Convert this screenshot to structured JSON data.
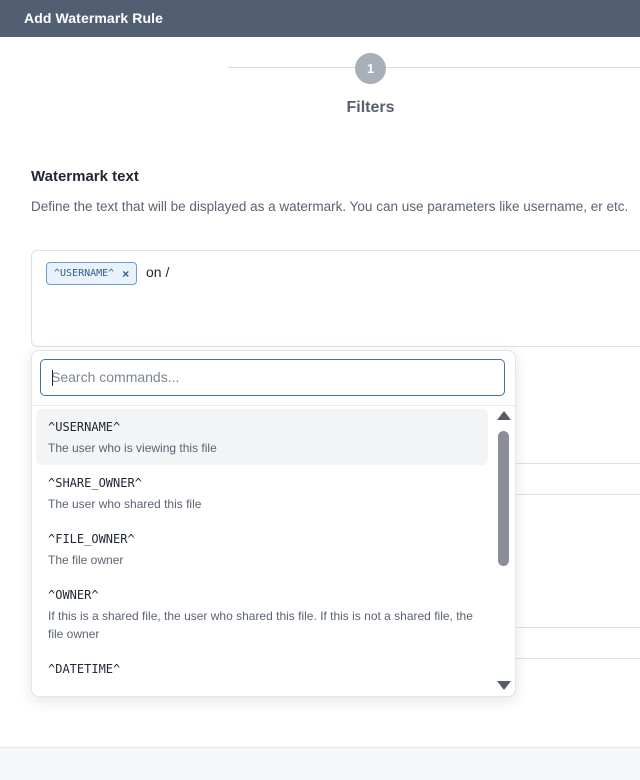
{
  "header": {
    "title": "Add Watermark Rule"
  },
  "stepper": {
    "step_number": "1",
    "step_label": "Filters"
  },
  "section": {
    "title": "Watermark text",
    "description": "Define the text that will be displayed as a watermark. You can use parameters like username, er etc."
  },
  "editor": {
    "tag_label": "^USERNAME^",
    "tag_remove": "×",
    "trailing_text": "on /"
  },
  "dropdown": {
    "search_placeholder": "Search commands...",
    "items": [
      {
        "name": "^USERNAME^",
        "description": "The user who is viewing this file"
      },
      {
        "name": "^SHARE_OWNER^",
        "description": "The user who shared this file"
      },
      {
        "name": "^FILE_OWNER^",
        "description": "The file owner"
      },
      {
        "name": "^OWNER^",
        "description": "If this is a shared file, the user who shared this file. If this is not a shared file, the file owner"
      },
      {
        "name": "^DATETIME^",
        "description": ""
      }
    ]
  },
  "colors": {
    "header_bg": "#525f73",
    "accent": "#3d74a8",
    "tag_border": "#6a9fd3",
    "tag_bg": "#e9f2fb"
  },
  "icons": {
    "tag_remove": "close-icon",
    "scroll_up": "chevron-up-icon",
    "scroll_down": "chevron-down-icon"
  }
}
